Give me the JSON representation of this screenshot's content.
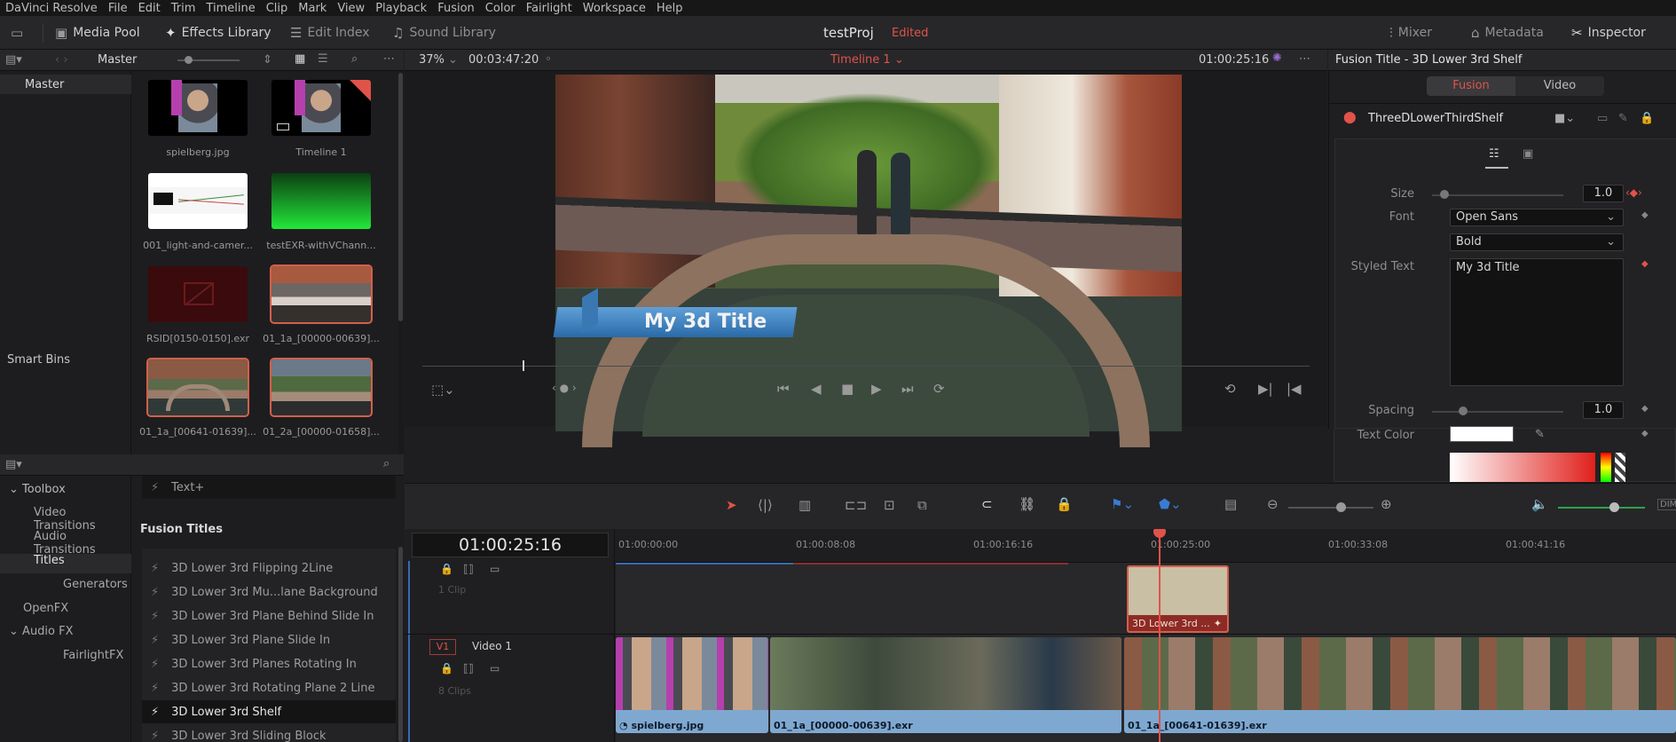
{
  "menu": [
    "DaVinci Resolve",
    "File",
    "Edit",
    "Trim",
    "Timeline",
    "Clip",
    "Mark",
    "View",
    "Playback",
    "Fusion",
    "Color",
    "Fairlight",
    "Workspace",
    "Help"
  ],
  "toolbar": {
    "media_pool": "Media Pool",
    "effects_library": "Effects Library",
    "edit_index": "Edit Index",
    "sound_library": "Sound Library",
    "project_name": "testProj",
    "project_status": "Edited",
    "mixer": "Mixer",
    "metadata": "Metadata",
    "inspector": "Inspector"
  },
  "media_pool": {
    "bin_name": "Master",
    "tree_master": "Master",
    "smart_bins": "Smart Bins",
    "clips": [
      {
        "name": "spielberg.jpg"
      },
      {
        "name": "Timeline 1"
      },
      {
        "name": "001_light-and-camer..."
      },
      {
        "name": "testEXR-withVChann..."
      },
      {
        "name": "RSID[0150-0150].exr"
      },
      {
        "name": "01_1a_[00000-00639]..."
      },
      {
        "name": "01_1a_[00641-01639]..."
      },
      {
        "name": "01_2a_[00000-01658]..."
      }
    ]
  },
  "effects": {
    "tree": [
      {
        "label": "Toolbox"
      },
      {
        "label": "Video Transitions"
      },
      {
        "label": "Audio Transitions"
      },
      {
        "label": "Titles"
      },
      {
        "label": "Generators"
      },
      {
        "label": "OpenFX"
      },
      {
        "label": "Audio FX"
      },
      {
        "label": "FairlightFX"
      }
    ],
    "top_item": "Text+",
    "section_title": "Fusion Titles",
    "items": [
      "3D Lower 3rd Flipping 2Line",
      "3D Lower 3rd Mu...lane Background",
      "3D Lower 3rd Plane Behind Slide In",
      "3D Lower 3rd Plane Slide In",
      "3D Lower 3rd Planes Rotating In",
      "3D Lower 3rd Rotating Plane 2 Line",
      "3D Lower 3rd Shelf",
      "3D Lower 3rd Sliding Block"
    ]
  },
  "viewer": {
    "zoom": "37%",
    "duration": "00:03:47:20",
    "timeline_name": "Timeline 1",
    "timecode": "01:00:25:16",
    "title_overlay": "My 3d Title",
    "playhead_fraction": 0.113
  },
  "inspector": {
    "header": "Fusion Title - 3D Lower 3rd Shelf",
    "tab_fusion": "Fusion",
    "tab_video": "Video",
    "node_name": "ThreeDLowerThirdShelf",
    "size_label": "Size",
    "size_value": "1.0",
    "font_label": "Font",
    "font_value": "Open Sans",
    "style_value": "Bold",
    "styled_text_label": "Styled Text",
    "styled_text_value": "My 3d Title",
    "spacing_label": "Spacing",
    "spacing_value": "1.0",
    "text_color_label": "Text Color",
    "text_color_value": "#ffffff"
  },
  "timeline": {
    "timecode": "01:00:25:16",
    "ruler": [
      "01:00:00:00",
      "01:00:08:08",
      "01:00:16:16",
      "01:00:25:00",
      "01:00:33:08",
      "01:00:41:16"
    ],
    "v2_info": "1 Clip",
    "v1_label": "V1",
    "v1_name": "Video 1",
    "v1_info": "8 Clips",
    "title_clip": "3D Lower 3rd ...",
    "clips": [
      "spielberg.jpg",
      "01_1a_[00000-00639].exr",
      "01_1a_[00641-01639].exr"
    ]
  },
  "colors": {
    "accent_red": "#e0534a",
    "clip_blue": "#7fa8d0",
    "title_clip_bg": "#c9bfa5"
  }
}
